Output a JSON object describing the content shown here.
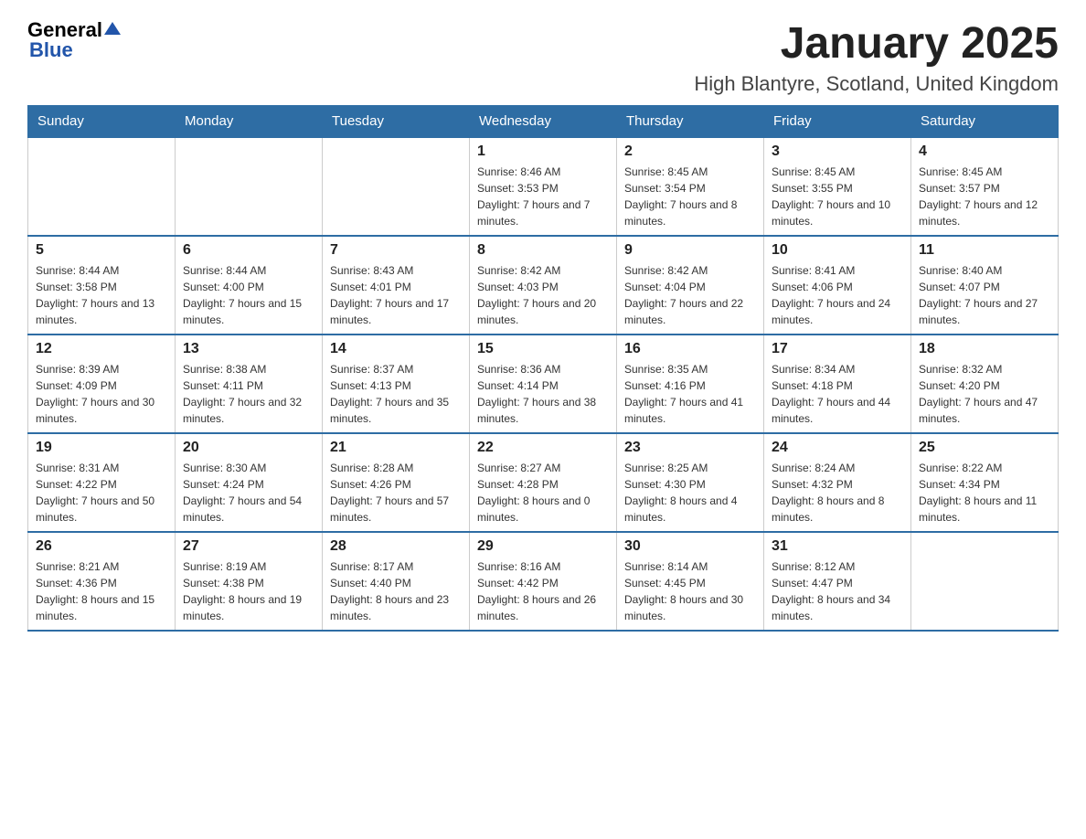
{
  "logo": {
    "text_general": "General",
    "text_blue": "Blue"
  },
  "title": "January 2025",
  "subtitle": "High Blantyre, Scotland, United Kingdom",
  "weekdays": [
    "Sunday",
    "Monday",
    "Tuesday",
    "Wednesday",
    "Thursday",
    "Friday",
    "Saturday"
  ],
  "weeks": [
    [
      {
        "day": "",
        "info": ""
      },
      {
        "day": "",
        "info": ""
      },
      {
        "day": "",
        "info": ""
      },
      {
        "day": "1",
        "info": "Sunrise: 8:46 AM\nSunset: 3:53 PM\nDaylight: 7 hours and 7 minutes."
      },
      {
        "day": "2",
        "info": "Sunrise: 8:45 AM\nSunset: 3:54 PM\nDaylight: 7 hours and 8 minutes."
      },
      {
        "day": "3",
        "info": "Sunrise: 8:45 AM\nSunset: 3:55 PM\nDaylight: 7 hours and 10 minutes."
      },
      {
        "day": "4",
        "info": "Sunrise: 8:45 AM\nSunset: 3:57 PM\nDaylight: 7 hours and 12 minutes."
      }
    ],
    [
      {
        "day": "5",
        "info": "Sunrise: 8:44 AM\nSunset: 3:58 PM\nDaylight: 7 hours and 13 minutes."
      },
      {
        "day": "6",
        "info": "Sunrise: 8:44 AM\nSunset: 4:00 PM\nDaylight: 7 hours and 15 minutes."
      },
      {
        "day": "7",
        "info": "Sunrise: 8:43 AM\nSunset: 4:01 PM\nDaylight: 7 hours and 17 minutes."
      },
      {
        "day": "8",
        "info": "Sunrise: 8:42 AM\nSunset: 4:03 PM\nDaylight: 7 hours and 20 minutes."
      },
      {
        "day": "9",
        "info": "Sunrise: 8:42 AM\nSunset: 4:04 PM\nDaylight: 7 hours and 22 minutes."
      },
      {
        "day": "10",
        "info": "Sunrise: 8:41 AM\nSunset: 4:06 PM\nDaylight: 7 hours and 24 minutes."
      },
      {
        "day": "11",
        "info": "Sunrise: 8:40 AM\nSunset: 4:07 PM\nDaylight: 7 hours and 27 minutes."
      }
    ],
    [
      {
        "day": "12",
        "info": "Sunrise: 8:39 AM\nSunset: 4:09 PM\nDaylight: 7 hours and 30 minutes."
      },
      {
        "day": "13",
        "info": "Sunrise: 8:38 AM\nSunset: 4:11 PM\nDaylight: 7 hours and 32 minutes."
      },
      {
        "day": "14",
        "info": "Sunrise: 8:37 AM\nSunset: 4:13 PM\nDaylight: 7 hours and 35 minutes."
      },
      {
        "day": "15",
        "info": "Sunrise: 8:36 AM\nSunset: 4:14 PM\nDaylight: 7 hours and 38 minutes."
      },
      {
        "day": "16",
        "info": "Sunrise: 8:35 AM\nSunset: 4:16 PM\nDaylight: 7 hours and 41 minutes."
      },
      {
        "day": "17",
        "info": "Sunrise: 8:34 AM\nSunset: 4:18 PM\nDaylight: 7 hours and 44 minutes."
      },
      {
        "day": "18",
        "info": "Sunrise: 8:32 AM\nSunset: 4:20 PM\nDaylight: 7 hours and 47 minutes."
      }
    ],
    [
      {
        "day": "19",
        "info": "Sunrise: 8:31 AM\nSunset: 4:22 PM\nDaylight: 7 hours and 50 minutes."
      },
      {
        "day": "20",
        "info": "Sunrise: 8:30 AM\nSunset: 4:24 PM\nDaylight: 7 hours and 54 minutes."
      },
      {
        "day": "21",
        "info": "Sunrise: 8:28 AM\nSunset: 4:26 PM\nDaylight: 7 hours and 57 minutes."
      },
      {
        "day": "22",
        "info": "Sunrise: 8:27 AM\nSunset: 4:28 PM\nDaylight: 8 hours and 0 minutes."
      },
      {
        "day": "23",
        "info": "Sunrise: 8:25 AM\nSunset: 4:30 PM\nDaylight: 8 hours and 4 minutes."
      },
      {
        "day": "24",
        "info": "Sunrise: 8:24 AM\nSunset: 4:32 PM\nDaylight: 8 hours and 8 minutes."
      },
      {
        "day": "25",
        "info": "Sunrise: 8:22 AM\nSunset: 4:34 PM\nDaylight: 8 hours and 11 minutes."
      }
    ],
    [
      {
        "day": "26",
        "info": "Sunrise: 8:21 AM\nSunset: 4:36 PM\nDaylight: 8 hours and 15 minutes."
      },
      {
        "day": "27",
        "info": "Sunrise: 8:19 AM\nSunset: 4:38 PM\nDaylight: 8 hours and 19 minutes."
      },
      {
        "day": "28",
        "info": "Sunrise: 8:17 AM\nSunset: 4:40 PM\nDaylight: 8 hours and 23 minutes."
      },
      {
        "day": "29",
        "info": "Sunrise: 8:16 AM\nSunset: 4:42 PM\nDaylight: 8 hours and 26 minutes."
      },
      {
        "day": "30",
        "info": "Sunrise: 8:14 AM\nSunset: 4:45 PM\nDaylight: 8 hours and 30 minutes."
      },
      {
        "day": "31",
        "info": "Sunrise: 8:12 AM\nSunset: 4:47 PM\nDaylight: 8 hours and 34 minutes."
      },
      {
        "day": "",
        "info": ""
      }
    ]
  ]
}
